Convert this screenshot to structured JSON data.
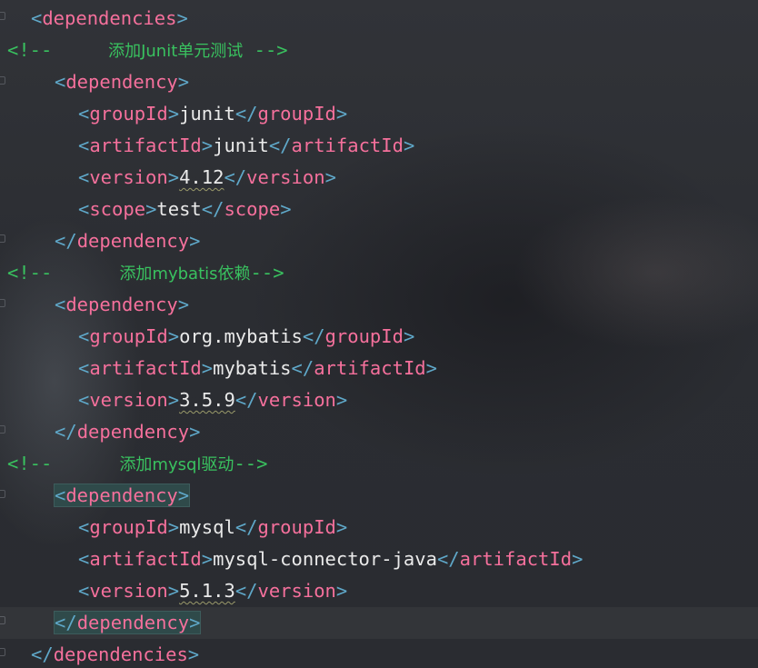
{
  "editor": {
    "lines": [
      {
        "kind": "open",
        "name": "dependencies"
      },
      {
        "kind": "comment",
        "open": "<!--",
        "text": "添加Junit单元测试",
        "close": "-->"
      },
      {
        "kind": "open",
        "name": "dependency"
      },
      {
        "kind": "element",
        "name": "groupId",
        "value": "junit"
      },
      {
        "kind": "element",
        "name": "artifactId",
        "value": "junit"
      },
      {
        "kind": "element",
        "name": "version",
        "value": "4.12"
      },
      {
        "kind": "element",
        "name": "scope",
        "value": "test"
      },
      {
        "kind": "close",
        "name": "dependency"
      },
      {
        "kind": "comment",
        "open": "<!--",
        "text": "添加mybatis依赖",
        "close": "-->"
      },
      {
        "kind": "open",
        "name": "dependency"
      },
      {
        "kind": "element",
        "name": "groupId",
        "value": "org.mybatis"
      },
      {
        "kind": "element",
        "name": "artifactId",
        "value": "mybatis"
      },
      {
        "kind": "element",
        "name": "version",
        "value": "3.5.9"
      },
      {
        "kind": "close",
        "name": "dependency"
      },
      {
        "kind": "comment",
        "open": "<!--",
        "text": "添加mysql驱动",
        "close": "-->"
      },
      {
        "kind": "open",
        "name": "dependency"
      },
      {
        "kind": "element",
        "name": "groupId",
        "value": "mysql"
      },
      {
        "kind": "element",
        "name": "artifactId",
        "value": "mysql-connector-java"
      },
      {
        "kind": "element",
        "name": "version",
        "value": "5.1.3"
      },
      {
        "kind": "close",
        "name": "dependency"
      },
      {
        "kind": "close",
        "name": "dependencies"
      }
    ]
  },
  "colors": {
    "tag": "#f5709c",
    "bracket": "#5fa8c9",
    "text": "#eaeaea",
    "comment": "#39c15f",
    "match_highlight": "#2f4a4a"
  },
  "icons": [
    "fold-marker-icon"
  ]
}
